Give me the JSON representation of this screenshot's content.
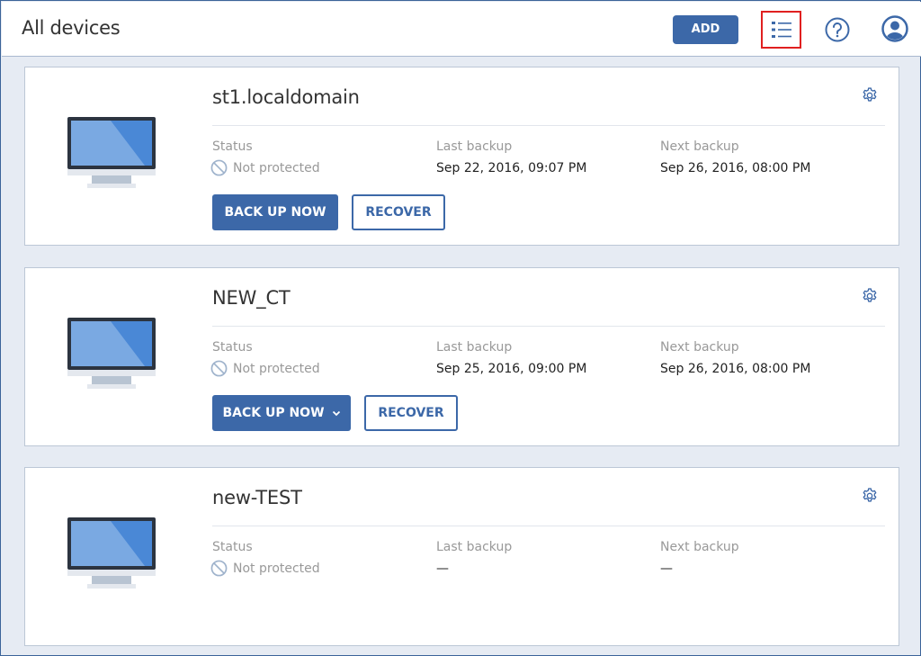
{
  "header": {
    "title": "All devices",
    "add_label": "ADD",
    "icons": {
      "list_view": "list-view-icon",
      "help": "help-icon",
      "account": "account-icon"
    }
  },
  "labels": {
    "status": "Status",
    "last_backup": "Last backup",
    "next_backup": "Next backup"
  },
  "colors": {
    "accent": "#3c68a8",
    "highlight": "#e02020",
    "background": "#e6ebf3"
  },
  "devices": [
    {
      "name": "st1.localdomain",
      "status": "Not protected",
      "last_backup": "Sep 22, 2016, 09:07 PM",
      "next_backup": "Sep 26, 2016, 08:00 PM",
      "backup_label": "BACK UP NOW",
      "recover_label": "RECOVER"
    },
    {
      "name": "NEW_CT",
      "status": "Not protected",
      "last_backup": "Sep 25, 2016, 09:00 PM",
      "next_backup": "Sep 26, 2016, 08:00 PM",
      "backup_label": "BACK UP NOW",
      "recover_label": "RECOVER"
    },
    {
      "name": "new-TEST",
      "status": "Not protected",
      "last_backup": "—",
      "next_backup": "—"
    }
  ]
}
